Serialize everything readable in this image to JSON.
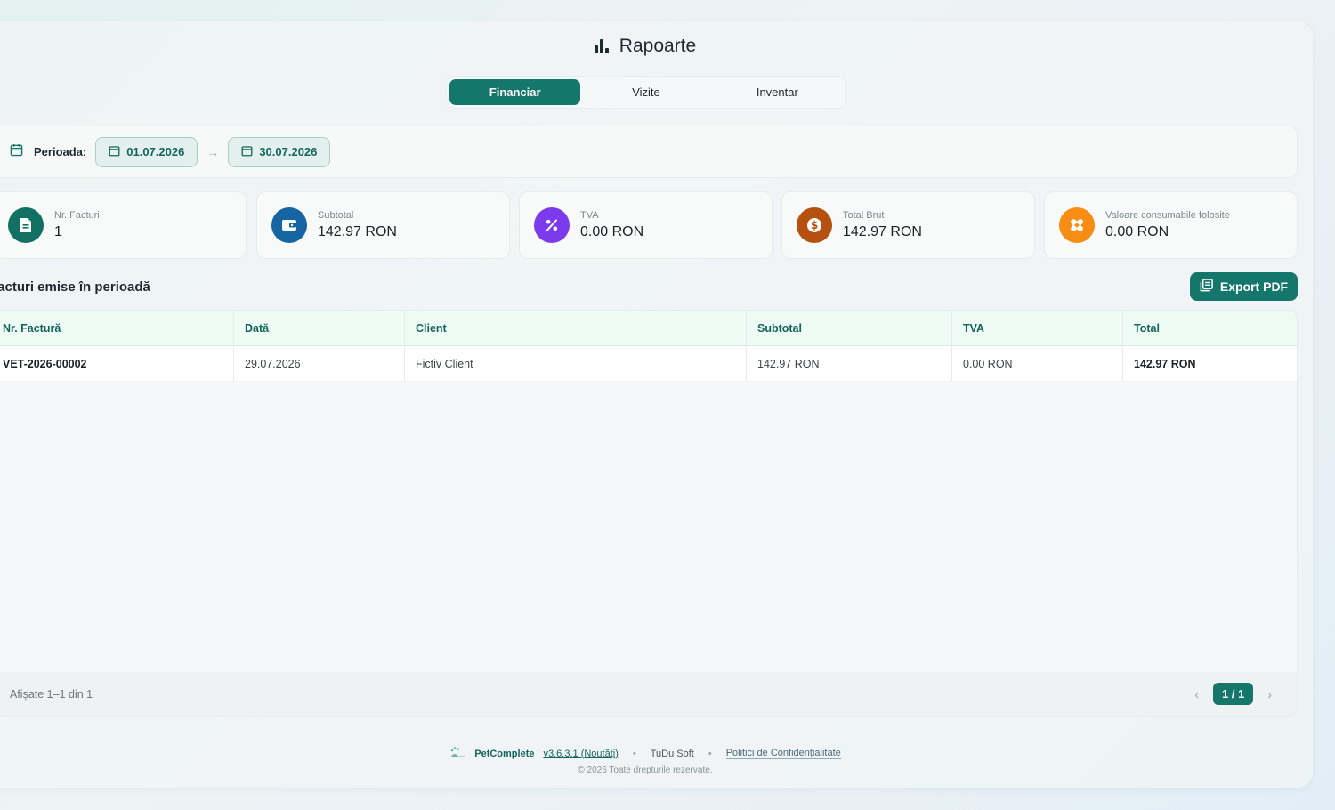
{
  "page": {
    "title": "Rapoarte",
    "title_icon": "bar-chart-icon"
  },
  "tabs": [
    {
      "label": "Financiar",
      "active": true
    },
    {
      "label": "Vizite",
      "active": false
    },
    {
      "label": "Inventar",
      "active": false
    }
  ],
  "period": {
    "label": "Perioada:",
    "start": "01.07.2026",
    "end": "30.07.2026",
    "separator": "→"
  },
  "cards": [
    {
      "label": "Nr. Facturi",
      "value": "1",
      "icon": "document-icon",
      "color": "#137163"
    },
    {
      "label": "Subtotal",
      "value": "142.97 RON",
      "icon": "wallet-icon",
      "color": "#1565a3"
    },
    {
      "label": "TVA",
      "value": "0.00 RON",
      "icon": "percent-icon",
      "color": "#7c3aed"
    },
    {
      "label": "Total Brut",
      "value": "142.97 RON",
      "icon": "dollar-icon",
      "color": "#b5500f"
    },
    {
      "label": "Valoare consumabile folosite",
      "value": "0.00 RON",
      "icon": "bandage-icon",
      "color": "#f78d14"
    }
  ],
  "section": {
    "title": "Facturi emise în perioadă"
  },
  "export": {
    "label": "Export PDF"
  },
  "table": {
    "columns": [
      "Nr. Factură",
      "Dată",
      "Client",
      "Subtotal",
      "TVA",
      "Total"
    ],
    "rows": [
      [
        "VET-2026-00002",
        "29.07.2026",
        "Fictiv Client",
        "142.97 RON",
        "0.00 RON",
        "142.97 RON"
      ]
    ],
    "showing": "Afișate 1–1 din 1",
    "page": "1 / 1"
  },
  "footer": {
    "brand": "PetComplete",
    "version": "v3.6.3.1 (Noutăți)",
    "company": "TuDu Soft",
    "policy": "Politici de Confidențialitate",
    "copyright": "© 2026 Toate drepturile rezervate."
  },
  "colors": {
    "accent": "#15766c",
    "header_bg": "#eefaf4"
  }
}
